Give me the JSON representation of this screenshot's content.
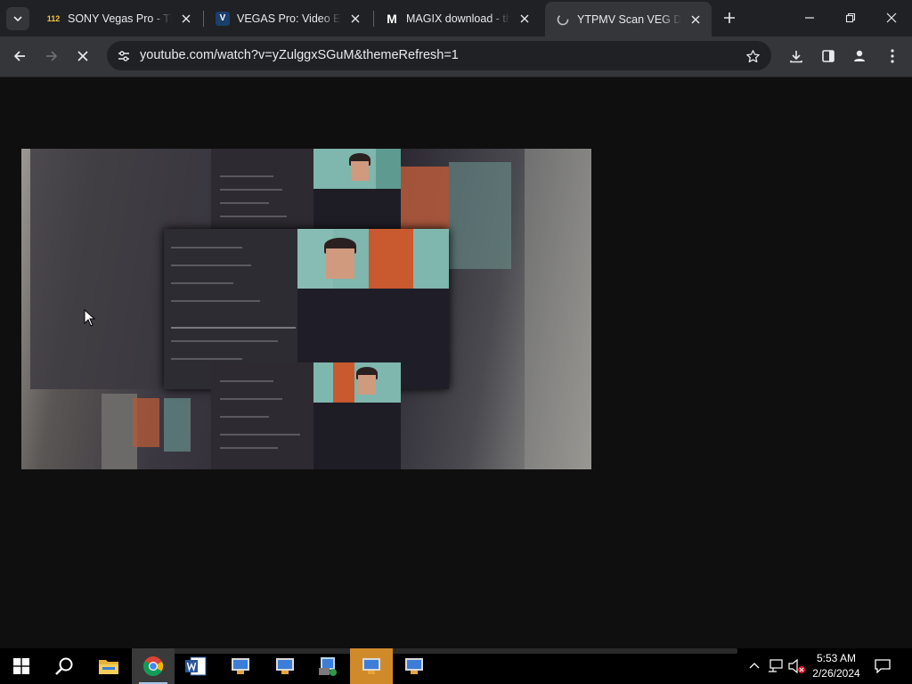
{
  "browser": {
    "tabs": [
      {
        "favicon_text": "112",
        "favicon_color": "#f2c744",
        "title": "SONY Vegas Pro - Tha",
        "active": false
      },
      {
        "favicon_text": "V",
        "favicon_color": "#1a3f6b",
        "title": "VEGAS Pro: Video Editi",
        "active": false
      },
      {
        "favicon_text": "M",
        "favicon_color": "#ffffff",
        "title": "MAGIX download - the",
        "active": false
      },
      {
        "favicon_text": "",
        "favicon_color": "#bdc1c6",
        "title": "YTPMV Scan VEG Dow",
        "active": true
      }
    ],
    "url": "youtube.com/watch?v=yZulggxSGuM&themeRefresh=1",
    "loading": true
  },
  "icons": {
    "tab_search": "chevron-down-icon",
    "back": "arrow-left-icon",
    "forward": "arrow-right-icon",
    "stop": "close-icon",
    "site_info": "tune-icon",
    "bookmark": "star-icon",
    "download": "download-icon",
    "side_panel": "side-panel-icon",
    "profile": "person-icon",
    "menu": "kebab-menu-icon"
  },
  "taskbar": {
    "apps": [
      "start",
      "search",
      "file-explorer",
      "chrome",
      "word",
      "vegas-1",
      "vegas-2",
      "vegas-3",
      "vegas-4",
      "vegas-5"
    ],
    "clock_time": "5:53 AM",
    "clock_date": "2/26/2024"
  },
  "colors": {
    "tabstrip": "#202124",
    "toolbar": "#35363a",
    "page_bg": "#0f0f0f",
    "taskbar": "#000000",
    "accent_orange": "#d18a2a"
  }
}
